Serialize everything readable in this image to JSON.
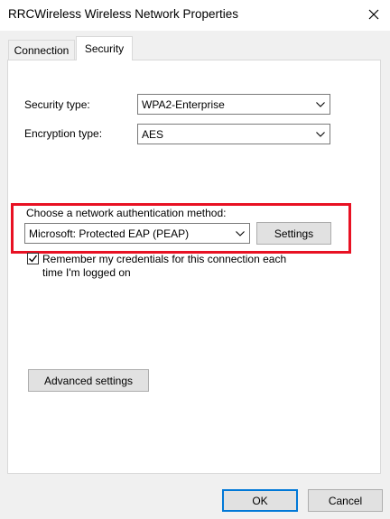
{
  "window": {
    "title": "RRCWireless Wireless Network Properties",
    "close_icon": "close-icon"
  },
  "tabs": [
    {
      "label": "Connection",
      "selected": false
    },
    {
      "label": "Security",
      "selected": true
    }
  ],
  "security": {
    "security_type_label": "Security type:",
    "security_type_value": "WPA2-Enterprise",
    "encryption_type_label": "Encryption type:",
    "encryption_type_value": "AES",
    "auth_method_label": "Choose a network authentication method:",
    "auth_method_value": "Microsoft: Protected EAP (PEAP)",
    "settings_button": "Settings",
    "remember_checked": true,
    "remember_label_line1": "Remember my credentials for this connection each",
    "remember_label_line2": "time I'm logged on",
    "advanced_settings_button": "Advanced settings"
  },
  "footer": {
    "ok_button": "OK",
    "cancel_button": "Cancel"
  },
  "colors": {
    "highlight_border": "#e81123",
    "default_button_border": "#0078d7",
    "dialog_background": "#f0f0f0"
  }
}
